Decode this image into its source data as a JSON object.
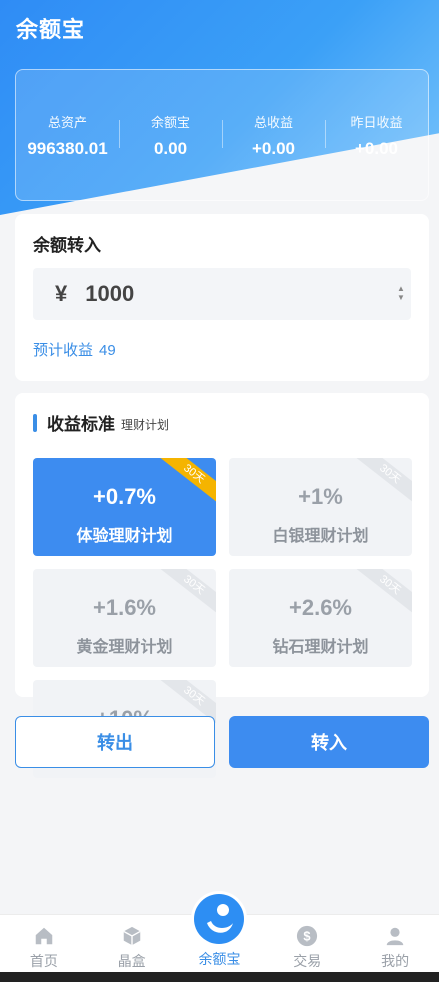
{
  "app": {
    "title": "余额宝"
  },
  "summary": [
    {
      "label": "总资产",
      "value": "996380.01"
    },
    {
      "label": "余额宝",
      "value": "0.00"
    },
    {
      "label": "总收益",
      "value": "+0.00"
    },
    {
      "label": "昨日收益",
      "value": "+0.00"
    }
  ],
  "transfer": {
    "title": "余额转入",
    "currency_symbol": "¥",
    "amount": "1000",
    "estimate_label": "预计收益",
    "estimate_value": "49"
  },
  "plans": {
    "title": "收益标准",
    "subtitle": "理财计划",
    "items": [
      {
        "rate": "+0.7%",
        "name": "体验理财计划",
        "badge": "30天",
        "selected": true
      },
      {
        "rate": "+1%",
        "name": "白银理财计划",
        "badge": "30天",
        "selected": false
      },
      {
        "rate": "+1.6%",
        "name": "黄金理财计划",
        "badge": "30天",
        "selected": false
      },
      {
        "rate": "+2.6%",
        "name": "钻石理财计划",
        "badge": "30天",
        "selected": false
      },
      {
        "rate": "+10%",
        "name": "",
        "badge": "30天",
        "selected": false
      }
    ]
  },
  "actions": {
    "transfer_out": "转出",
    "transfer_in": "转入"
  },
  "tabbar": [
    {
      "label": "首页",
      "icon": "home-icon"
    },
    {
      "label": "晶盒",
      "icon": "box-icon"
    },
    {
      "label": "余额宝",
      "icon": "yuebao-logo-icon",
      "active": true
    },
    {
      "label": "交易",
      "icon": "dollar-coin-icon"
    },
    {
      "label": "我的",
      "icon": "user-icon"
    }
  ],
  "colors": {
    "primary": "#3d8cf0",
    "accent_badge": "#f5b400",
    "text_muted": "#9aa0a8"
  }
}
